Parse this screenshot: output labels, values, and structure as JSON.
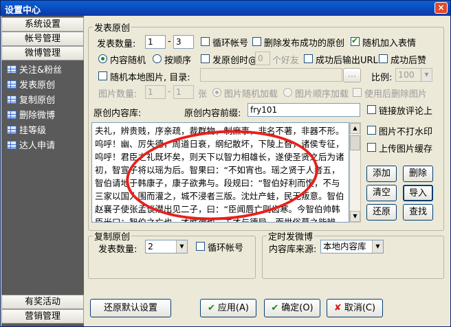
{
  "window": {
    "title": "设置中心",
    "close": "×"
  },
  "sidebar": {
    "top_buttons": [
      "系统设置",
      "帐号管理",
      "微博管理"
    ],
    "items": [
      "关注&粉丝",
      "发表原创",
      "复制原创",
      "删除微博",
      "挂等级",
      "达人申请"
    ],
    "bottom_buttons": [
      "有奖活动",
      "营销管理"
    ]
  },
  "post": {
    "legend": "发表原创",
    "count_label": "发表数量:",
    "count_from": "1",
    "count_dash": "-",
    "count_to": "3",
    "loop_account": "循环帐号",
    "delete_after": "删除发布成功的原创",
    "random_emoji": "随机加入表情",
    "radio_random": "内容随机",
    "radio_order": "按顺序",
    "at_prefix": "发原创时@",
    "at_count": "0",
    "at_suffix": "个好友",
    "output_url": "成功后输出URL",
    "like_after": "成功后赞",
    "local_image": "随机本地图片, 目录:",
    "browse": "...",
    "ratio_label": "比例:",
    "ratio_value": "100",
    "image_count_label": "图片数量:",
    "image_from": "1",
    "image_to": "1",
    "image_unit": "张",
    "image_random_load": "图片随机加载",
    "image_order_load": "图片顺序加载",
    "delete_image_after": "使用后删除图片",
    "content_lib_label": "原创内容库:",
    "prefix_label": "原创内容前缀:",
    "prefix_value": "fry101",
    "link_in_comment": "链接放评论上",
    "no_watermark": "图片不打水印",
    "upload_cache": "上传图片缓存",
    "content_text": "夫礼，辨贵贱，序亲疏，裁群物，制庶事，非名不著，非器不形。呜呼！幽、厉失德，周道日衰，纲纪散坏，下陵上替，诸侯专征，呜呼！君臣之礼既坏矣，则天下以智力相雄长，遂使圣贤之后为诸初，智宣子将以瑶为后。智果曰：“不如宵也。瑶之贤于人者五，智伯请地于韩康子，康子欲弗与。段规曰：“智伯好利而愎，不与三家以国人围而灌之，城不浸者三版。沈灶产蛙，民无叛意。智伯赵襄子使张孟谈潜出见二子，曰：“臣闻唇亡则齿寒。今智伯帅韩臣光曰：智伯之亡也，才胜德也。夫才与德异，而世俗莫之能辨，三家分智氏之田。赵襄子漆智伯之头，以为饮器。智伯之臣豫让欲"
  },
  "buttons": {
    "add": "添加",
    "delete": "删除",
    "clear": "清空",
    "import": "导入",
    "restore": "还原",
    "find": "查找",
    "restore_default": "还原默认设置",
    "apply": "应用(A)",
    "ok": "确定(O)",
    "cancel": "取消(C)"
  },
  "copy": {
    "legend": "复制原创",
    "count_label": "发表数量:",
    "count_value": "2",
    "loop_account": "循环帐号"
  },
  "timed": {
    "legend": "定时发微博",
    "source_label": "内容库来源:",
    "source_value": "本地内容库"
  },
  "colors": {
    "annotation_circle": "#e8201c",
    "titlebar": "#0a5fd8"
  }
}
